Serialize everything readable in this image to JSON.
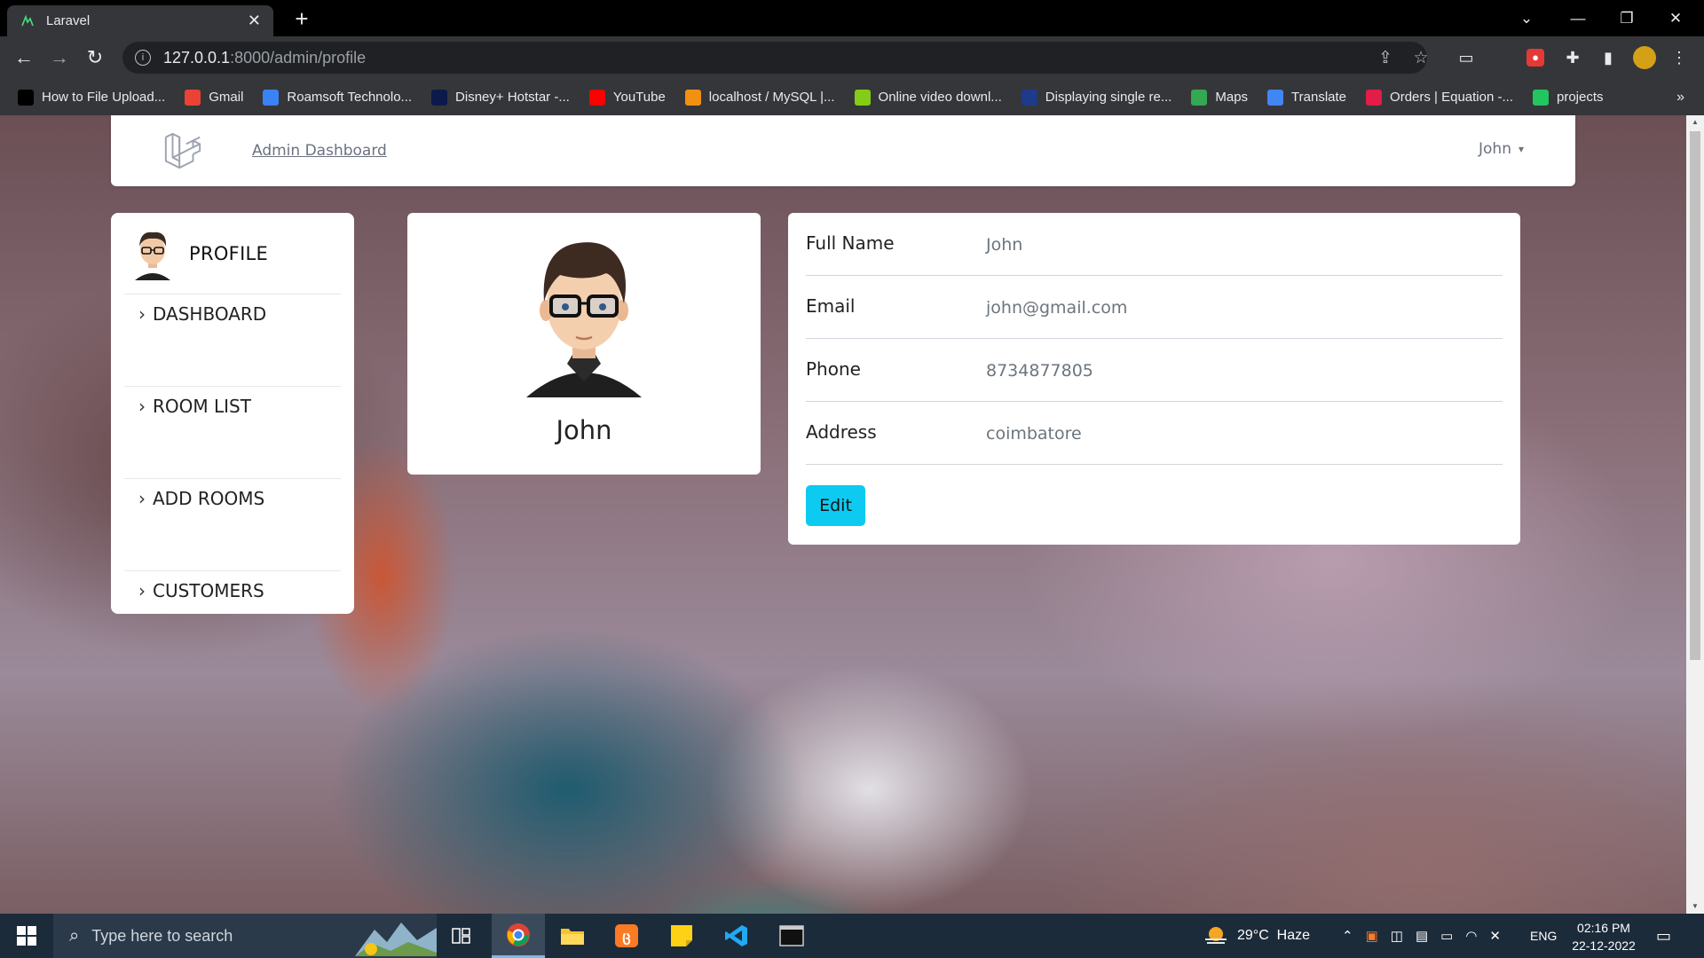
{
  "browser": {
    "tab_title": "Laravel",
    "tab_close": "✕",
    "new_tab": "+",
    "url_host": "127.0.0.1",
    "url_path": ":8000/admin/profile",
    "bookmarks": [
      {
        "label": "How to File Upload...",
        "icon": "github-icon",
        "color": "#000000"
      },
      {
        "label": "Gmail",
        "icon": "gmail-icon",
        "color": "#ea4335"
      },
      {
        "label": "Roamsoft Technolo...",
        "icon": "roamsoft-icon",
        "color": "#3b82f6"
      },
      {
        "label": "Disney+ Hotstar -...",
        "icon": "hotstar-icon",
        "color": "#0c1a4b"
      },
      {
        "label": "YouTube",
        "icon": "youtube-icon",
        "color": "#ff0000"
      },
      {
        "label": "localhost / MySQL |...",
        "icon": "phpmyadmin-icon",
        "color": "#f29111"
      },
      {
        "label": "Online video downl...",
        "icon": "download-icon",
        "color": "#84cc16"
      },
      {
        "label": "Displaying single re...",
        "icon": "w3-icon",
        "color": "#1e3a8a"
      },
      {
        "label": "Maps",
        "icon": "maps-icon",
        "color": "#34a853"
      },
      {
        "label": "Translate",
        "icon": "translate-icon",
        "color": "#4285f4"
      },
      {
        "label": "Orders | Equation -...",
        "icon": "equation-icon",
        "color": "#e11d48"
      },
      {
        "label": "projects",
        "icon": "projects-icon",
        "color": "#22c55e"
      }
    ],
    "bookmarks_more": "»"
  },
  "topbar": {
    "dashboard_link": "Admin Dashboard",
    "user_name": "John"
  },
  "sidebar": {
    "profile_label": "PROFILE",
    "items": [
      {
        "label": "DASHBOARD"
      },
      {
        "label": "ROOM LIST"
      },
      {
        "label": "ADD ROOMS"
      },
      {
        "label": "CUSTOMERS"
      }
    ]
  },
  "profile_card": {
    "name": "John"
  },
  "details": {
    "rows": [
      {
        "key": "Full Name",
        "value": "John"
      },
      {
        "key": "Email",
        "value": "john@gmail.com"
      },
      {
        "key": "Phone",
        "value": "8734877805"
      },
      {
        "key": "Address",
        "value": "coimbatore"
      }
    ],
    "edit_label": "Edit"
  },
  "taskbar": {
    "search_placeholder": "Type here to search",
    "weather": "29°C  Haze",
    "language": "ENG",
    "time": "02:16 PM",
    "date": "22-12-2022"
  },
  "colors": {
    "accent_button": "#0dcaf0",
    "laravel_logo": "#9ca3af"
  }
}
